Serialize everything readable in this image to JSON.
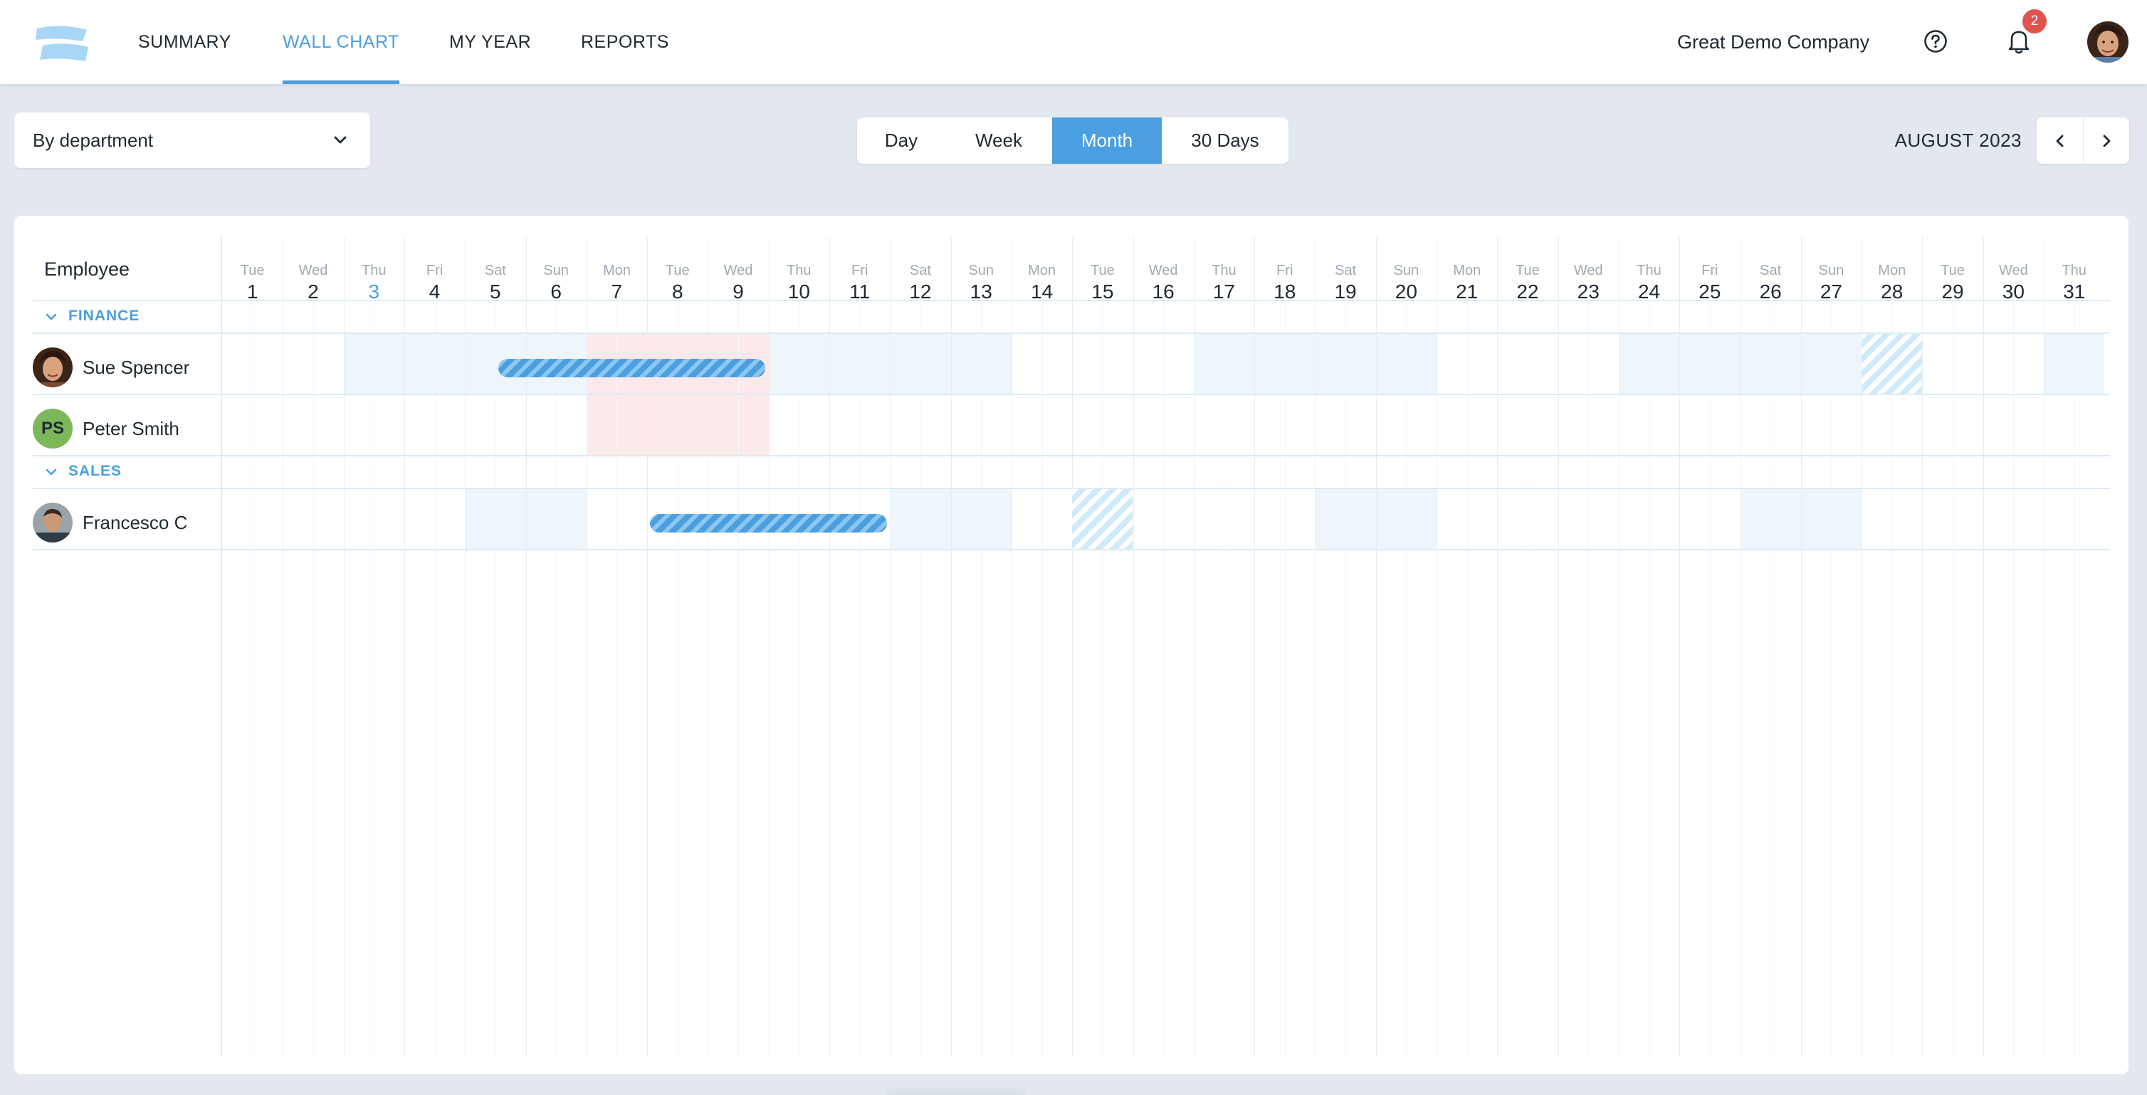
{
  "nav": {
    "items": [
      {
        "label": "SUMMARY",
        "active": false
      },
      {
        "label": "WALL CHART",
        "active": true
      },
      {
        "label": "MY YEAR",
        "active": false
      },
      {
        "label": "REPORTS",
        "active": false
      }
    ],
    "company": "Great Demo Company",
    "notification_count": "2",
    "icons": [
      "logo-icon",
      "help-icon",
      "bell-icon",
      "user-avatar"
    ]
  },
  "toolbar": {
    "group_by": "By department",
    "views": [
      {
        "label": "Day",
        "active": false
      },
      {
        "label": "Week",
        "active": false
      },
      {
        "label": "Month",
        "active": true
      },
      {
        "label": "30 Days",
        "active": false
      }
    ],
    "period": "AUGUST 2023"
  },
  "wallchart": {
    "employee_header": "Employee",
    "days": [
      {
        "dow": "Tue",
        "num": "1"
      },
      {
        "dow": "Wed",
        "num": "2"
      },
      {
        "dow": "Thu",
        "num": "3",
        "today": true
      },
      {
        "dow": "Fri",
        "num": "4"
      },
      {
        "dow": "Sat",
        "num": "5"
      },
      {
        "dow": "Sun",
        "num": "6"
      },
      {
        "dow": "Mon",
        "num": "7"
      },
      {
        "dow": "Tue",
        "num": "8"
      },
      {
        "dow": "Wed",
        "num": "9"
      },
      {
        "dow": "Thu",
        "num": "10"
      },
      {
        "dow": "Fri",
        "num": "11"
      },
      {
        "dow": "Sat",
        "num": "12"
      },
      {
        "dow": "Sun",
        "num": "13"
      },
      {
        "dow": "Mon",
        "num": "14"
      },
      {
        "dow": "Tue",
        "num": "15"
      },
      {
        "dow": "Wed",
        "num": "16"
      },
      {
        "dow": "Thu",
        "num": "17"
      },
      {
        "dow": "Fri",
        "num": "18"
      },
      {
        "dow": "Sat",
        "num": "19"
      },
      {
        "dow": "Sun",
        "num": "20"
      },
      {
        "dow": "Mon",
        "num": "21"
      },
      {
        "dow": "Tue",
        "num": "22"
      },
      {
        "dow": "Wed",
        "num": "23"
      },
      {
        "dow": "Thu",
        "num": "24"
      },
      {
        "dow": "Fri",
        "num": "25"
      },
      {
        "dow": "Sat",
        "num": "26"
      },
      {
        "dow": "Sun",
        "num": "27"
      },
      {
        "dow": "Mon",
        "num": "28"
      },
      {
        "dow": "Tue",
        "num": "29"
      },
      {
        "dow": "Wed",
        "num": "30"
      },
      {
        "dow": "Thu",
        "num": "31"
      }
    ],
    "departments": [
      {
        "name": "FINANCE",
        "employees": [
          {
            "name": "Sue Spencer",
            "avatar": "photo-female",
            "shaded_days": [
              [
                3,
                6
              ],
              [
                10,
                13
              ],
              [
                17,
                20
              ],
              [
                24,
                27
              ],
              [
                31,
                31
              ]
            ],
            "bookings": [
              {
                "start": 5.5,
                "end": 9.9
              }
            ],
            "pending": [
              {
                "start": 28,
                "end": 28
              }
            ],
            "holidays": [
              [
                7,
                9
              ]
            ]
          },
          {
            "name": "Peter Smith",
            "initials": "PS",
            "shaded_days": [],
            "bookings": [],
            "pending": [],
            "holidays": [
              [
                7,
                9
              ]
            ]
          }
        ]
      },
      {
        "name": "SALES",
        "employees": [
          {
            "name": "Francesco C",
            "avatar": "photo-male",
            "shaded_days": [
              [
                5,
                6
              ],
              [
                12,
                13
              ],
              [
                19,
                20
              ],
              [
                26,
                27
              ]
            ],
            "bookings": [
              {
                "start": 8.0,
                "end": 11.9
              }
            ],
            "pending": [
              {
                "start": 15,
                "end": 15
              }
            ],
            "holidays": []
          }
        ]
      }
    ],
    "colors": {
      "accent": "#4a9fe0",
      "weekend_shade": "#eef6fb",
      "holiday_shade": "#fde9e9",
      "booking": "#4a9fe0",
      "pending": "#cfeaf8",
      "badge": "#e0534f",
      "initials_bg": "#7cb85a"
    }
  }
}
